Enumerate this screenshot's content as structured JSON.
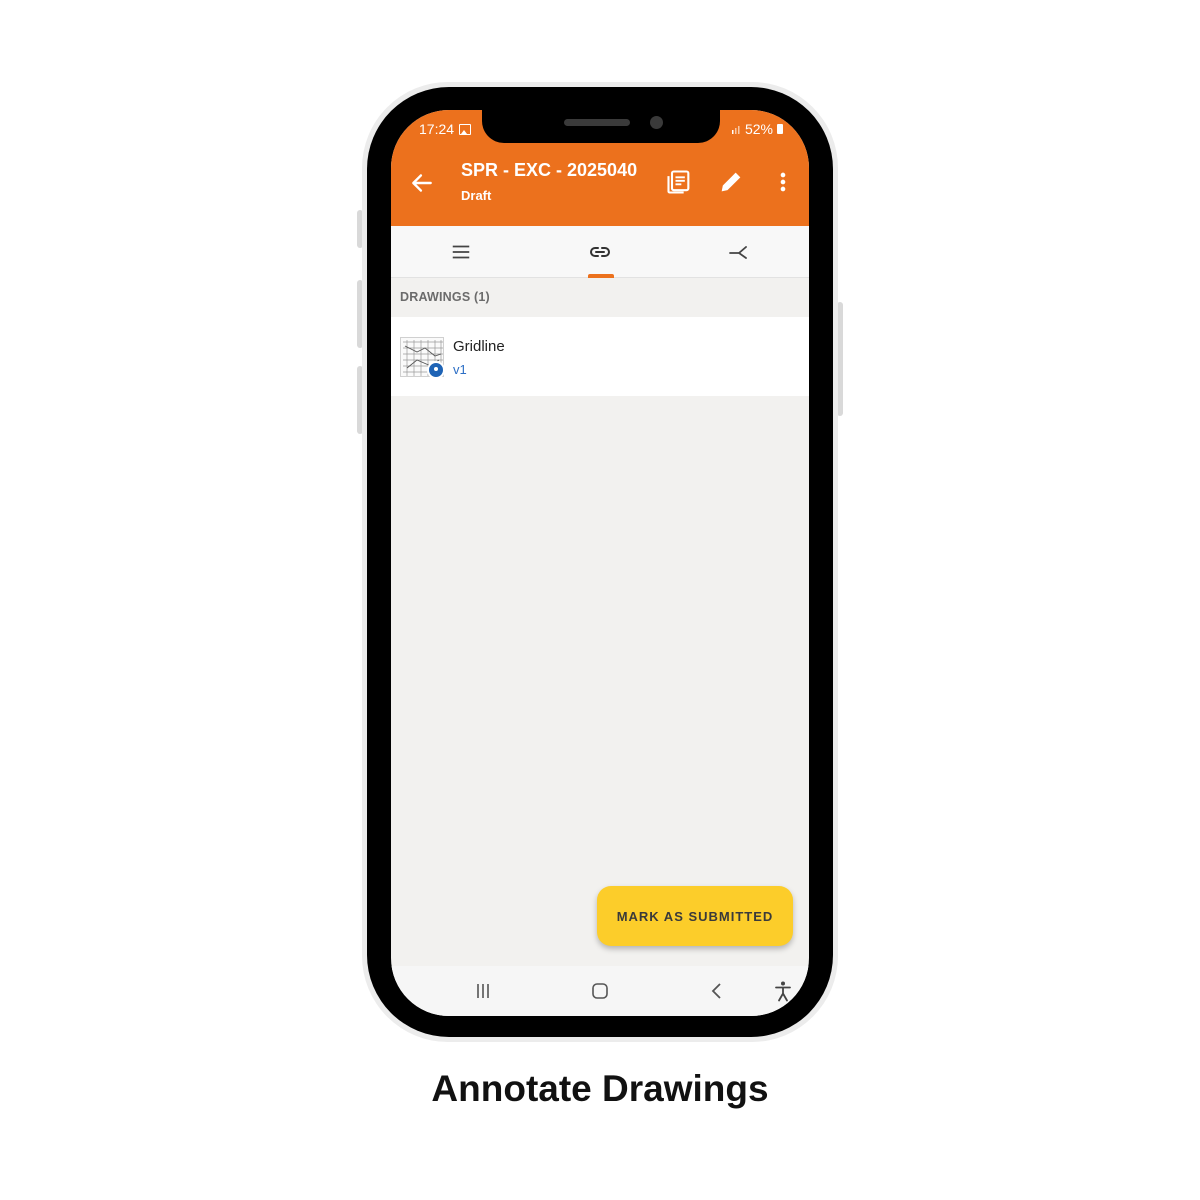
{
  "status_bar": {
    "time": "17:24",
    "battery": "52%"
  },
  "app_bar": {
    "title": "SPR - EXC - 2025040",
    "subtitle": "Draft",
    "background_color": "#ec711d"
  },
  "tabs": [
    {
      "icon": "list-icon",
      "active": false
    },
    {
      "icon": "link-icon",
      "active": true
    },
    {
      "icon": "merge-icon",
      "active": false
    }
  ],
  "drawings": {
    "header": "DRAWINGS (1)",
    "items": [
      {
        "name": "Gridline",
        "version": "v1",
        "icon": "pin-icon"
      }
    ]
  },
  "fab": {
    "label": "MARK AS SUBMITTED",
    "color": "#fccd2a"
  },
  "caption": "Annotate Drawings"
}
